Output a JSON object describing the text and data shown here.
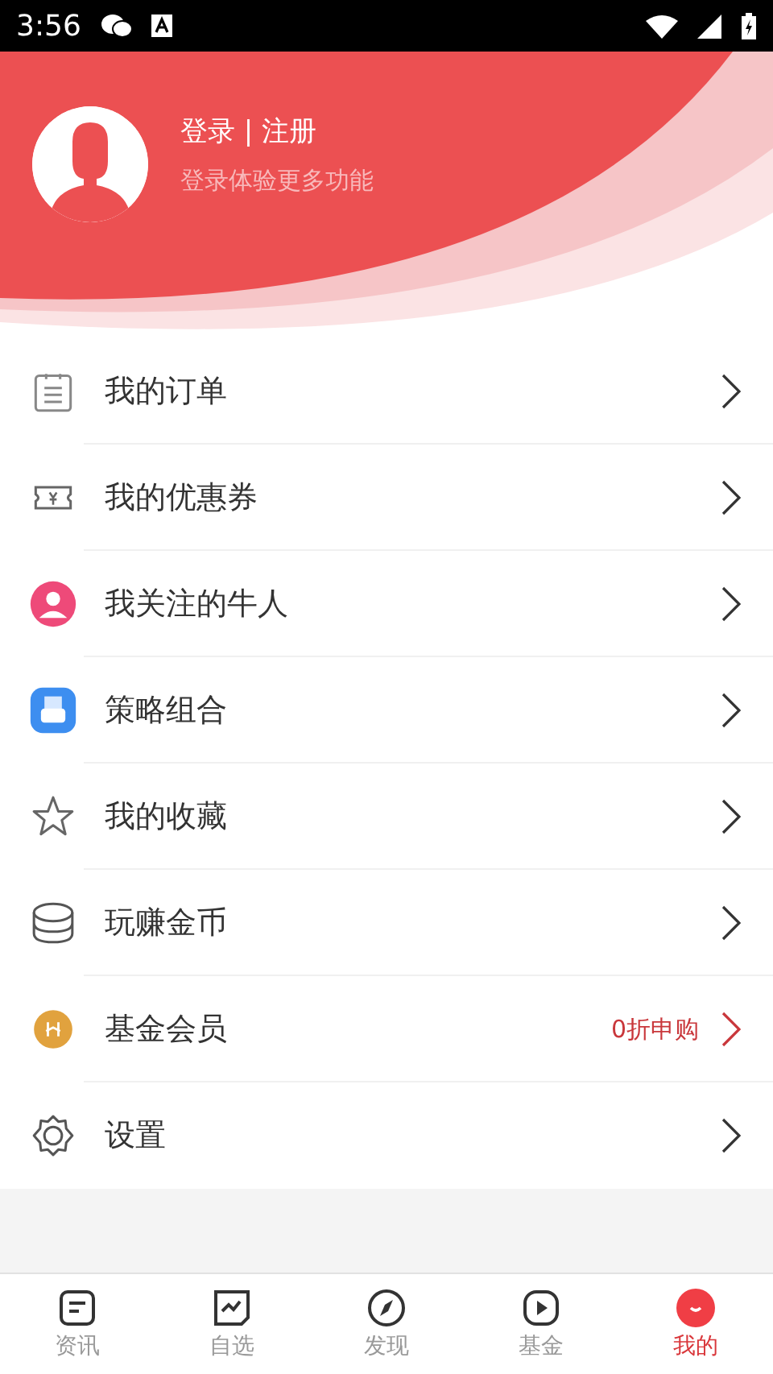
{
  "status_bar": {
    "time": "3:56"
  },
  "profile": {
    "title": "登录 | 注册",
    "subtitle": "登录体验更多功能"
  },
  "menu": [
    {
      "label": "我的订单"
    },
    {
      "label": "我的优惠券"
    },
    {
      "label": "我关注的牛人"
    },
    {
      "label": "策略组合"
    },
    {
      "label": "我的收藏"
    },
    {
      "label": "玩赚金币"
    },
    {
      "label": "基金会员",
      "note": "0折申购"
    },
    {
      "label": "设置"
    }
  ],
  "tabs": [
    {
      "label": "资讯",
      "selected": false
    },
    {
      "label": "自选",
      "selected": false
    },
    {
      "label": "发现",
      "selected": false
    },
    {
      "label": "基金",
      "selected": false
    },
    {
      "label": "我的",
      "selected": true
    }
  ]
}
